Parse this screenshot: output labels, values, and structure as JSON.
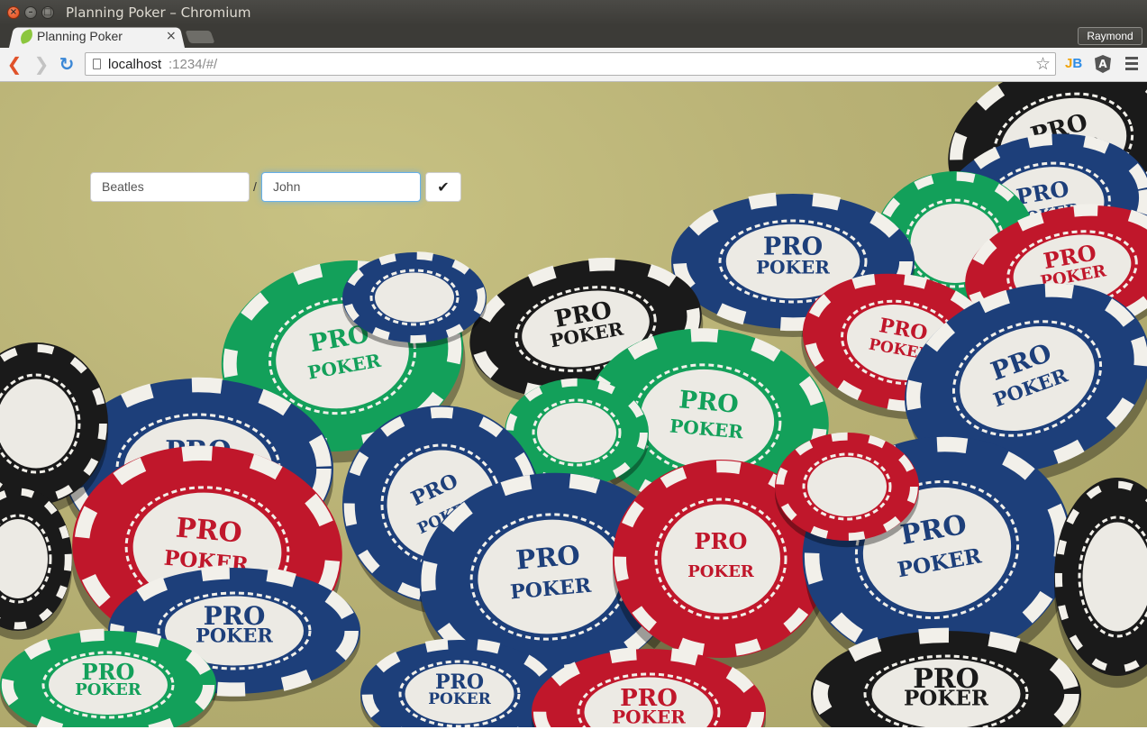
{
  "window": {
    "title": "Planning Poker – Chromium",
    "close_glyph": "×",
    "min_glyph": "–",
    "max_glyph": "□"
  },
  "tabs": [
    {
      "label": "Planning Poker",
      "close_glyph": "×",
      "active": true
    }
  ],
  "profile": {
    "name": "Raymond"
  },
  "toolbar": {
    "back_glyph": "❮",
    "forward_glyph": "❯",
    "reload_glyph": "↻",
    "url_host": "localhost",
    "url_path": ":1234/#/",
    "star_glyph": "☆",
    "extensions": [
      {
        "icon": "jetbrains-icon",
        "text_j": "J",
        "text_b": "B"
      },
      {
        "icon": "angular-icon",
        "text": "A"
      }
    ],
    "menu_icon": "hamburger-menu-icon"
  },
  "form": {
    "team_value": "Beatles",
    "separator": "/",
    "name_value": "John",
    "submit_glyph": "✔"
  },
  "colors": {
    "felt": "#bbb472",
    "focus_ring": "#66afe9",
    "chip_green": "#13a05a",
    "chip_red": "#c0172b",
    "chip_blue": "#1d3f7a",
    "chip_black": "#1a1a1a"
  },
  "chip_text": {
    "line1": "PRO",
    "line2": "POKER"
  }
}
